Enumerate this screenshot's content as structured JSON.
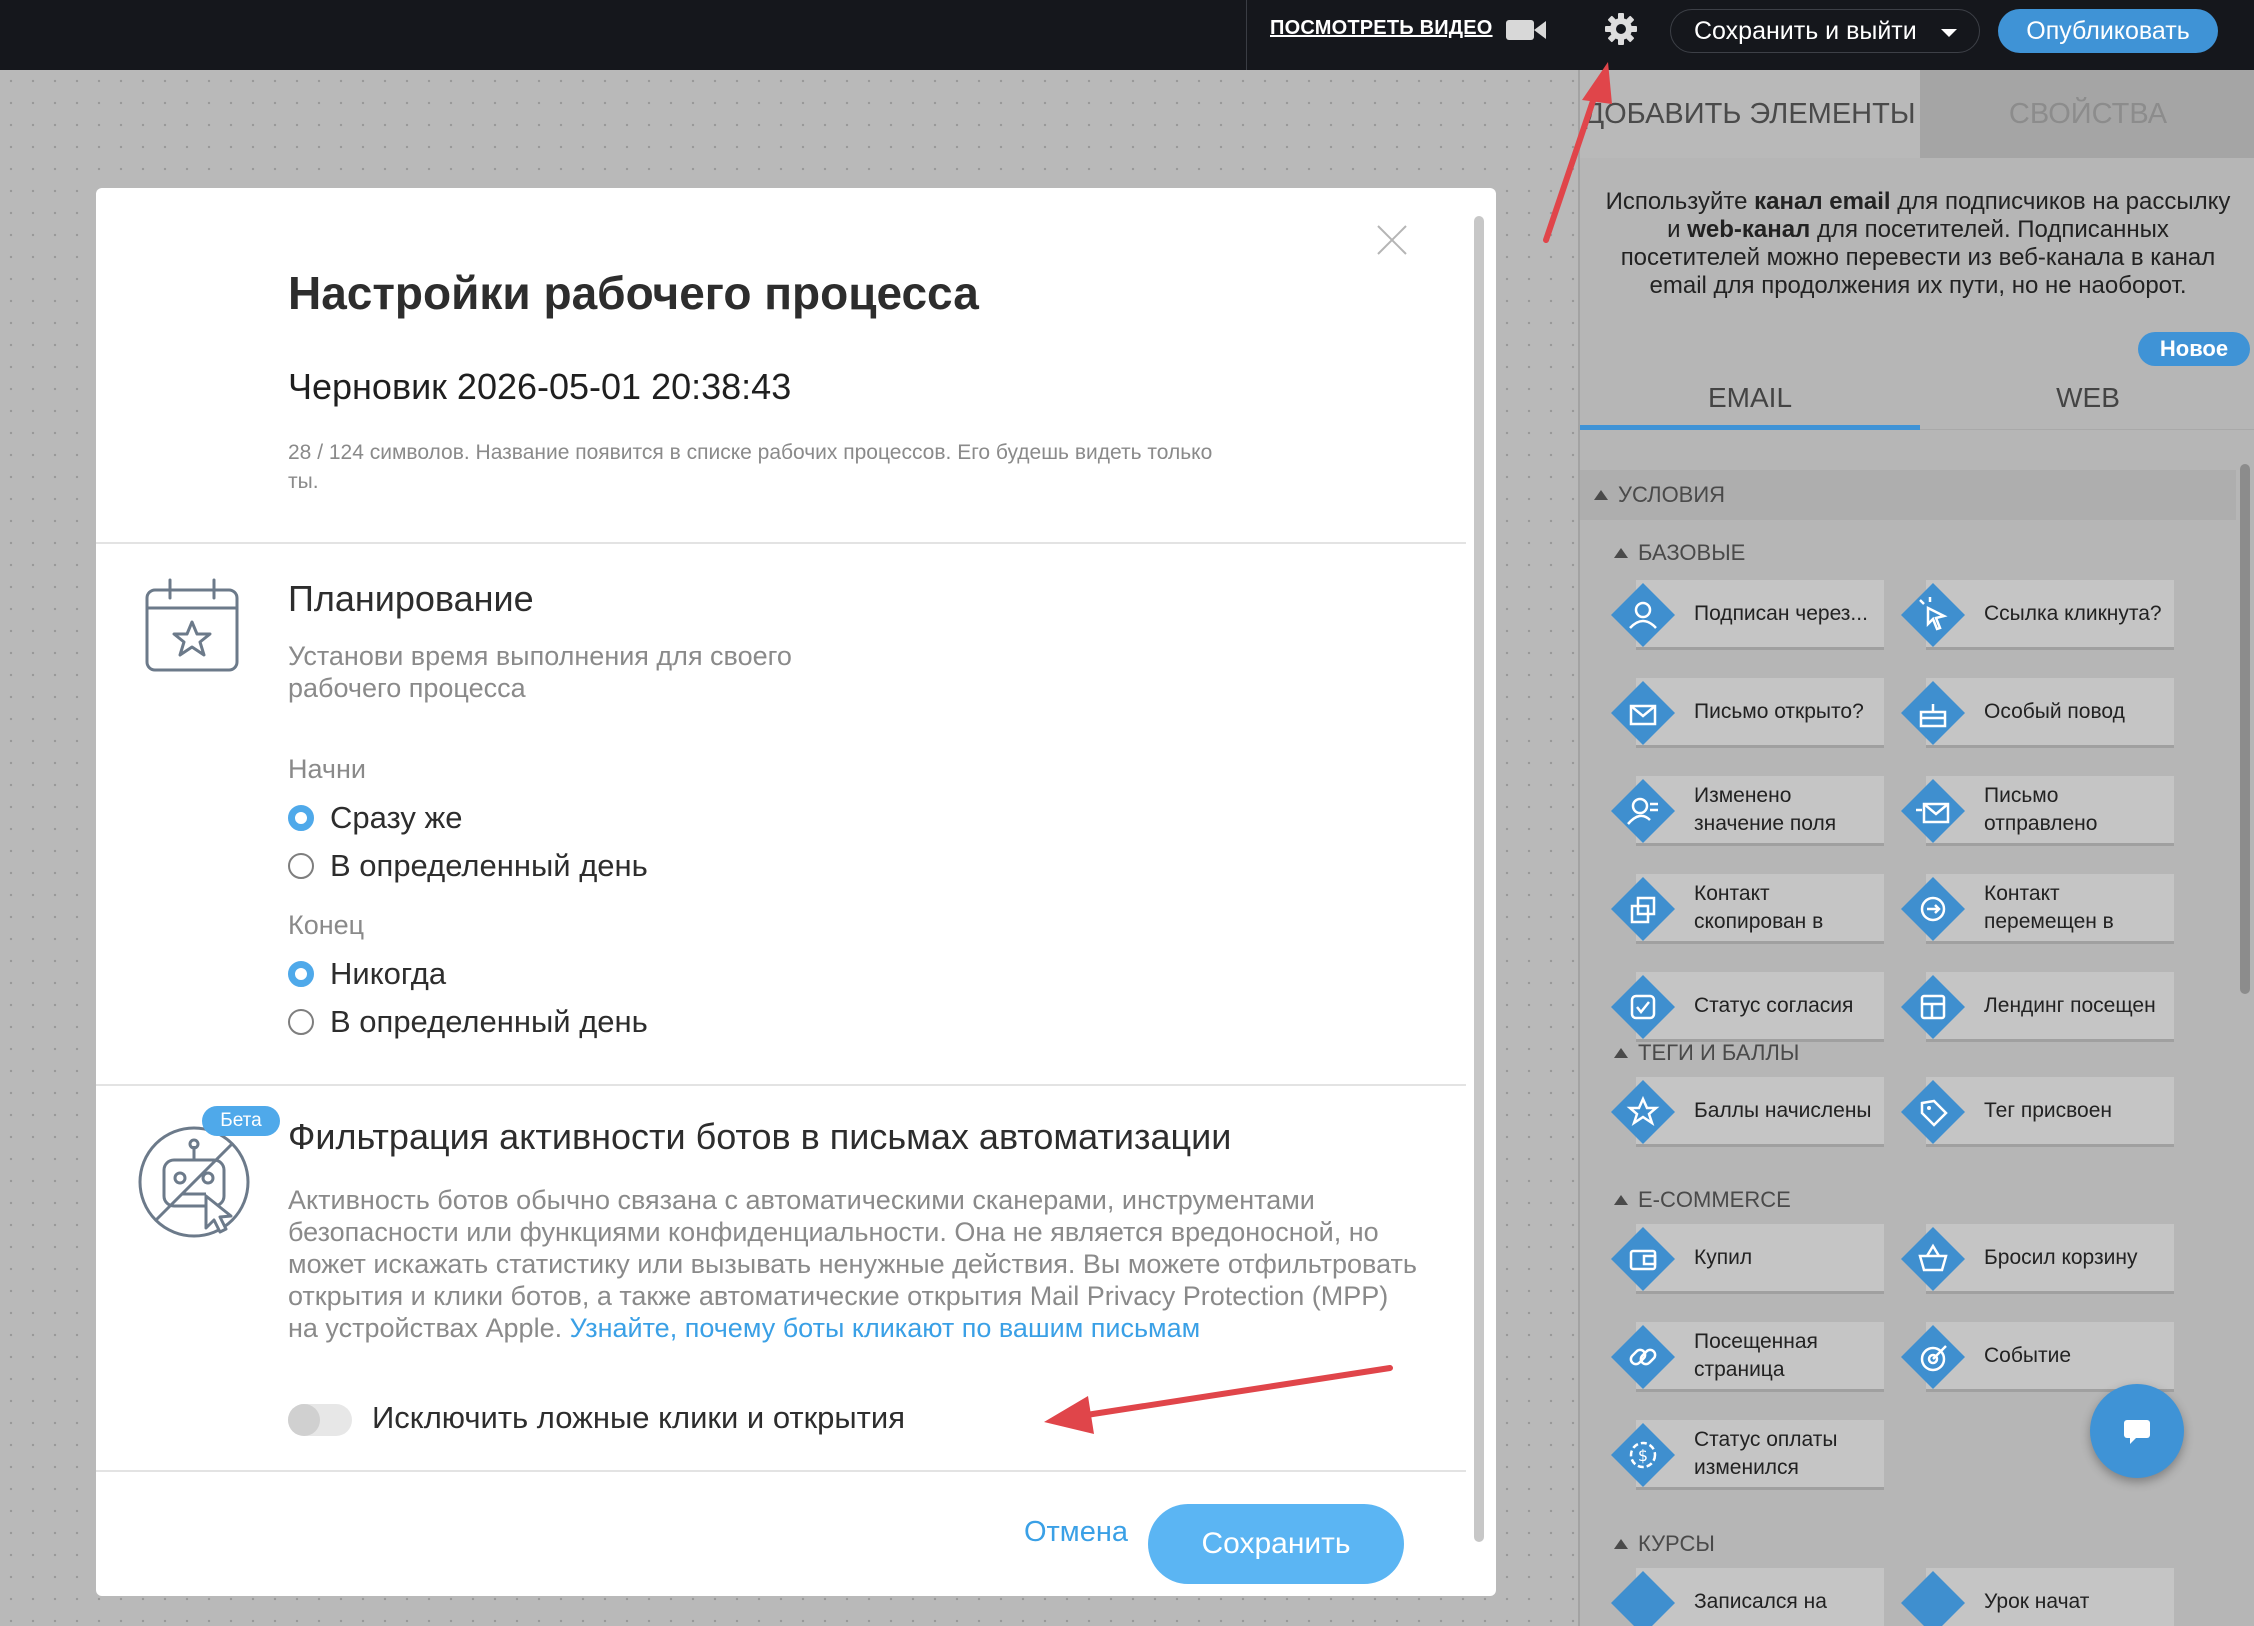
{
  "topbar": {
    "watch_video": "ПОСМОТРЕТЬ ВИДЕО",
    "save_exit": "Сохранить и выйти",
    "publish": "Опубликовать"
  },
  "panel": {
    "tab_add": "ДОБАВИТЬ ЭЛЕМЕНТЫ",
    "tab_props": "СВОЙСТВА",
    "info_parts": [
      "Используйте ",
      "канал email",
      " для подписчиков на рассылку и ",
      "web-канал",
      " для посетителей. Подписанных посетителей можно перевести из веб-канала в канал email для продолжения их пути, но не наоборот."
    ],
    "new_badge": "Новое",
    "tab_email": "EMAIL",
    "tab_web": "WEB",
    "sec_conditions": "УСЛОВИЯ",
    "sub_basic": "БАЗОВЫЕ",
    "sub_tags": "ТЕГИ И БАЛЛЫ",
    "sub_ecom": "E-COMMERCE",
    "sub_courses": "КУРСЫ",
    "basic": [
      {
        "label": "Подписан через...",
        "icon": "user-icon"
      },
      {
        "label": "Ссылка кликнута?",
        "icon": "cursor-click-icon"
      },
      {
        "label": "Письмо открыто?",
        "icon": "envelope-open-icon"
      },
      {
        "label": "Особый повод",
        "icon": "cake-icon"
      },
      {
        "label": "Изменено значение поля",
        "icon": "user-edit-icon"
      },
      {
        "label": "Письмо отправлено",
        "icon": "envelope-send-icon"
      },
      {
        "label": "Контакт скопирован в",
        "icon": "copy-icon"
      },
      {
        "label": "Контакт перемещен в",
        "icon": "arrow-circle-icon"
      },
      {
        "label": "Статус согласия",
        "icon": "check-circle-icon"
      },
      {
        "label": "Лендинг посещен",
        "icon": "layout-icon"
      }
    ],
    "tags": [
      {
        "label": "Баллы начислены",
        "icon": "star-icon"
      },
      {
        "label": "Тег присвоен",
        "icon": "tag-icon"
      }
    ],
    "ecom": [
      {
        "label": "Купил",
        "icon": "wallet-icon"
      },
      {
        "label": "Бросил корзину",
        "icon": "basket-icon"
      },
      {
        "label": "Посещенная страница",
        "icon": "link-icon"
      },
      {
        "label": "Событие",
        "icon": "target-icon"
      },
      {
        "label": "Статус оплаты изменился",
        "icon": "payment-icon"
      }
    ],
    "courses": [
      {
        "label": "Записался на"
      },
      {
        "label": "Урок начат"
      }
    ]
  },
  "modal": {
    "title": "Настройки рабочего процесса",
    "workflow_name": "Черновик 2026-05-01 20:38:43",
    "name_hint": "28 / 124 символов. Название появится в списке рабочих процессов. Его будешь видеть только ты.",
    "schedule_title": "Планирование",
    "schedule_desc": "Установи время выполнения для своего рабочего процесса",
    "start_label": "Начни",
    "start_opt1": "Сразу же",
    "start_opt2": "В определенный день",
    "end_label": "Конец",
    "end_opt1": "Никогда",
    "end_opt2": "В определенный день",
    "beta": "Бета",
    "bot_title": "Фильтрация активности ботов в письмах автоматизации",
    "bot_desc": "Активность ботов обычно связана с автоматическими сканерами, инструментами безопасности или функциями конфиденциальности. Она не является вредоносной, но может искажать статистику или вызывать ненужные действия. Вы можете отфильтровать открытия и клики ботов, а также автоматические открытия Mail Privacy Protection (MPP) на устройствах Apple. ",
    "bot_link": "Узнайте, почему боты кликают по вашим письмам",
    "toggle_label": "Исключить ложные клики и открытия",
    "cancel": "Отмена",
    "save": "Сохранить"
  }
}
